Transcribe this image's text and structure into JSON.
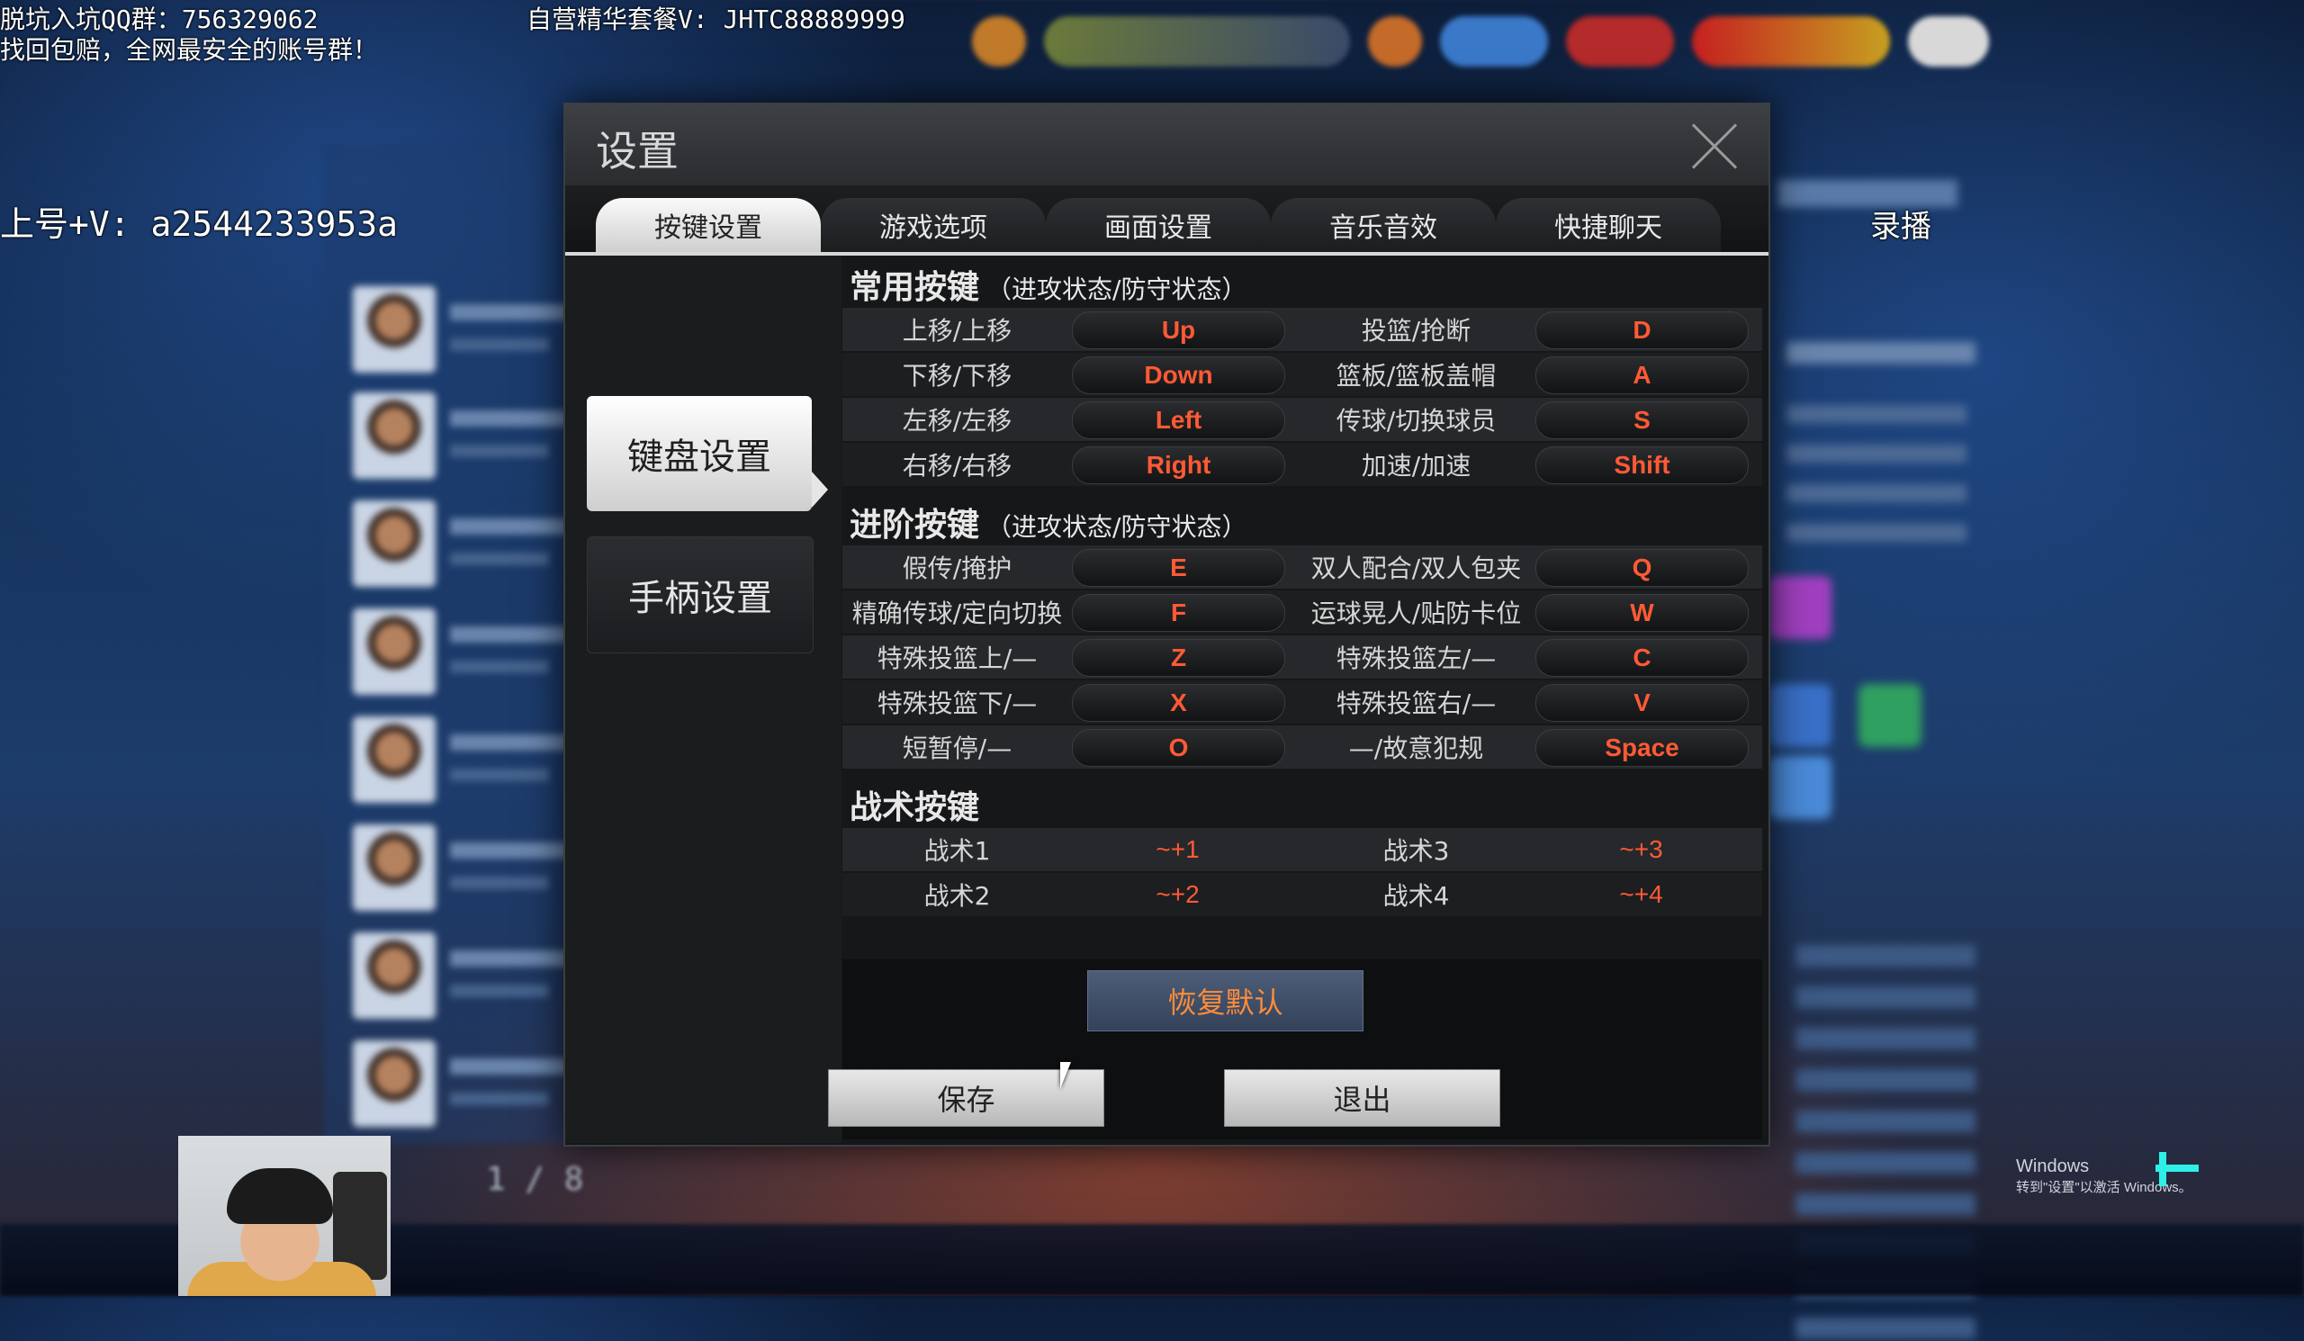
{
  "overlay": {
    "line1": "脱坑入坑QQ群：756329062",
    "line2": "找回包赔，全网最安全的账号群！",
    "center": "自营精华套餐V: JHTC88889999",
    "left_mid": "上号+V: a2544233953a",
    "replay": "录播"
  },
  "dialog": {
    "title": "设置",
    "tabs": [
      {
        "label": "按键设置",
        "active": true
      },
      {
        "label": "游戏选项",
        "active": false
      },
      {
        "label": "画面设置",
        "active": false
      },
      {
        "label": "音乐音效",
        "active": false
      },
      {
        "label": "快捷聊天",
        "active": false
      }
    ],
    "side": [
      {
        "label": "键盘设置",
        "active": true
      },
      {
        "label": "手柄设置",
        "active": false
      }
    ],
    "sections": {
      "common": {
        "title": "常用按键",
        "sub": "（进攻状态/防守状态）",
        "rows": [
          {
            "l1": "上移/上移",
            "k1": "Up",
            "l2": "投篮/抢断",
            "k2": "D"
          },
          {
            "l1": "下移/下移",
            "k1": "Down",
            "l2": "篮板/篮板盖帽",
            "k2": "A"
          },
          {
            "l1": "左移/左移",
            "k1": "Left",
            "l2": "传球/切换球员",
            "k2": "S"
          },
          {
            "l1": "右移/右移",
            "k1": "Right",
            "l2": "加速/加速",
            "k2": "Shift"
          }
        ]
      },
      "advanced": {
        "title": "进阶按键",
        "sub": "（进攻状态/防守状态）",
        "rows": [
          {
            "l1": "假传/掩护",
            "k1": "E",
            "l2": "双人配合/双人包夹",
            "k2": "Q"
          },
          {
            "l1": "精确传球/定向切换",
            "k1": "F",
            "l2": "运球晃人/贴防卡位",
            "k2": "W"
          },
          {
            "l1": "特殊投篮上/—",
            "k1": "Z",
            "l2": "特殊投篮左/—",
            "k2": "C"
          },
          {
            "l1": "特殊投篮下/—",
            "k1": "X",
            "l2": "特殊投篮右/—",
            "k2": "V"
          },
          {
            "l1": "短暂停/—",
            "k1": "O",
            "l2": "—/故意犯规",
            "k2": "Space"
          }
        ]
      },
      "tactics": {
        "title": "战术按键",
        "rows": [
          {
            "l1": "战术1",
            "k1": "~+1",
            "l2": "战术3",
            "k2": "~+3"
          },
          {
            "l1": "战术2",
            "k1": "~+2",
            "l2": "战术4",
            "k2": "~+4"
          }
        ]
      }
    },
    "reset_label": "恢复默认",
    "save_label": "保存",
    "exit_label": "退出"
  },
  "background": {
    "pager": "1 / 8"
  },
  "watermark": {
    "line1": "Windows",
    "line2": "转到\"设置\"以激活 Windows。"
  },
  "colors": {
    "key_text": "#ff5a35",
    "reset_text": "#ff8c3a",
    "dialog_bg": "#151719"
  }
}
